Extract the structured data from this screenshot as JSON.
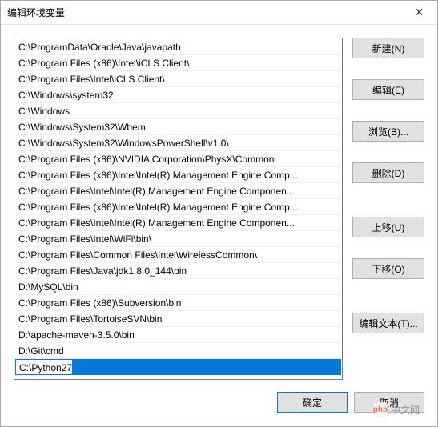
{
  "window": {
    "title": "编辑环境变量"
  },
  "list": {
    "items": [
      "C:\\ProgramData\\Oracle\\Java\\javapath",
      "C:\\Program Files (x86)\\Intel\\iCLS Client\\",
      "C:\\Program Files\\Intel\\iCLS Client\\",
      "C:\\Windows\\system32",
      "C:\\Windows",
      "C:\\Windows\\System32\\Wbem",
      "C:\\Windows\\System32\\WindowsPowerShell\\v1.0\\",
      "C:\\Program Files (x86)\\NVIDIA Corporation\\PhysX\\Common",
      "C:\\Program Files (x86)\\Intel\\Intel(R) Management Engine Comp...",
      "C:\\Program Files\\Intel\\Intel(R) Management Engine Componen...",
      "C:\\Program Files (x86)\\Intel\\Intel(R) Management Engine Comp...",
      "C:\\Program Files\\Intel\\Intel(R) Management Engine Componen...",
      "C:\\Program Files\\Intel\\WiFi\\bin\\",
      "C:\\Program Files\\Common Files\\Intel\\WirelessCommon\\",
      "C:\\Program Files\\Java\\jdk1.8.0_144\\bin",
      "D:\\MySQL\\bin",
      "C:\\Program Files (x86)\\Subversion\\bin",
      "C:\\Program Files\\TortoiseSVN\\bin",
      "D:\\apache-maven-3.5.0\\bin",
      "D:\\Git\\cmd"
    ],
    "editing_value": "C:\\Python27"
  },
  "buttons": {
    "new": "新建(N)",
    "edit": "编辑(E)",
    "browse": "浏览(B)...",
    "delete": "删除(D)",
    "moveup": "上移(U)",
    "movedown": "下移(O)",
    "edittext": "编辑文本(T)..."
  },
  "footer": {
    "ok": "确定",
    "cancel": "取消"
  },
  "watermark": {
    "logo": "php",
    "text": "中文网"
  }
}
